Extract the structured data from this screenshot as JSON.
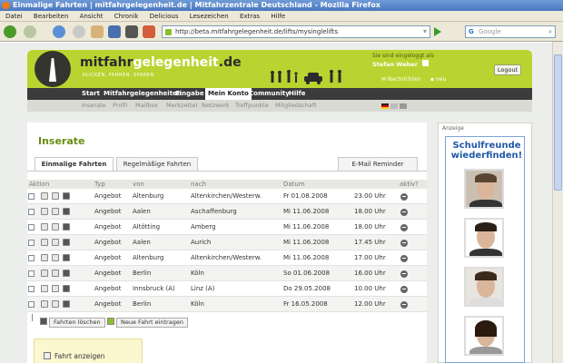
{
  "window": {
    "title": "Einmalige Fahrten | mitfahrgelegenheit.de | Mitfahrzentrale Deutschland - Mozilla Firefox"
  },
  "menu": [
    "Datei",
    "Bearbeiten",
    "Ansicht",
    "Chronik",
    "Delicious",
    "Lesezeichen",
    "Extras",
    "Hilfe"
  ],
  "browser": {
    "url": "http://beta.mitfahrgelegenheit.de/lifts/mysinglelifts",
    "search_placeholder": "Google"
  },
  "site": {
    "logo_main": "mitfahr",
    "logo_accent": "gelegenheit",
    "logo_tld": ".de",
    "slogan": "KLICKEN. FAHREN. SPAREN.",
    "logged_in_label": "Sie sind eingeloggt als",
    "username": "Stefan Weber",
    "logout": "Logout",
    "messages": "Nachrichten",
    "new": "neu"
  },
  "mainnav": [
    "Start",
    "Mitfahrgelegenheiten",
    "Eingabe",
    "Mein Konto",
    "Community",
    "Hilfe"
  ],
  "subnav": [
    "Inserate",
    "Profil",
    "Mailbox",
    "Merkzettel",
    "Netzwerk",
    "Treffpunkte",
    "Mitgliedschaft"
  ],
  "page": {
    "title": "Inserate",
    "tabs": [
      "Einmalige Fahrten",
      "Regelmäßige Fahrten"
    ],
    "reminder_tab": "E-Mail Reminder"
  },
  "table": {
    "headers": [
      "Aktion",
      "Typ",
      "von",
      "nach",
      "Datum",
      "aktiv?"
    ],
    "rows": [
      {
        "typ": "Angebot",
        "von": "Altenburg",
        "nach": "Altenkirchen/Westerw.",
        "datum": "Fr 01.08.2008",
        "zeit": "23.00 Uhr"
      },
      {
        "typ": "Angebot",
        "von": "Aalen",
        "nach": "Aschaffenburg",
        "datum": "Mi 11.06.2008",
        "zeit": "18.00 Uhr"
      },
      {
        "typ": "Angebot",
        "von": "Altötting",
        "nach": "Amberg",
        "datum": "Mi 11.06.2008",
        "zeit": "18.00 Uhr"
      },
      {
        "typ": "Angebot",
        "von": "Aalen",
        "nach": "Aurich",
        "datum": "Mi 11.06.2008",
        "zeit": "17.45 Uhr"
      },
      {
        "typ": "Angebot",
        "von": "Altenburg",
        "nach": "Altenkirchen/Westerw.",
        "datum": "Mi 11.06.2008",
        "zeit": "17.00 Uhr"
      },
      {
        "typ": "Angebot",
        "von": "Berlin",
        "nach": "Köln",
        "datum": "So 01.06.2008",
        "zeit": "16.00 Uhr"
      },
      {
        "typ": "Angebot",
        "von": "Innsbruck (A)",
        "nach": "Linz (A)",
        "datum": "Do 29.05.2008",
        "zeit": "10.00 Uhr"
      },
      {
        "typ": "Angebot",
        "von": "Berlin",
        "nach": "Köln",
        "datum": "Fr 16.05.2008",
        "zeit": "12.00 Uhr"
      }
    ]
  },
  "actions": {
    "delete": "Fahrten löschen",
    "new": "Neue Fahrt eintragen"
  },
  "sidebar_box": {
    "label": "Fahrt anzeigen"
  },
  "ad": {
    "label": "Anzeige",
    "title": "Schulfreunde wiederfinden!"
  },
  "colors": {
    "brand_green": "#b9d430",
    "dark": "#3b3b3b",
    "title_green": "#6a8e12"
  }
}
